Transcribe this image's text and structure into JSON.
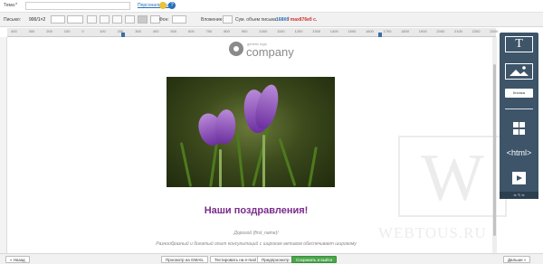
{
  "topbar": {
    "subject_label": "Тема:*",
    "subject_value": "",
    "personalize_link": "Персонализация"
  },
  "toolbar": {
    "letter_label": "Письмо:",
    "width_value": "900/1×2",
    "background_label": "Фон:",
    "attachment_label": "Вложение:",
    "total_size_label": "Сум. объем письма:",
    "total_size_value": "168Кб",
    "size_limit_value": "/ max876кб с."
  },
  "ruler": {
    "ticks": [
      "400",
      "300",
      "200",
      "100",
      "0",
      "100",
      "200",
      "300",
      "400",
      "500",
      "600",
      "700",
      "800",
      "900",
      "1000",
      "1100",
      "1200",
      "1300",
      "1400",
      "1500",
      "1600",
      "1700",
      "1800",
      "1900",
      "2000",
      "2100",
      "2200",
      "2300"
    ]
  },
  "email": {
    "logo_small": "generic logo",
    "logo_big": "company",
    "heading": "Наши поздравления!",
    "greeting": "Дорогой {first_name}!",
    "body_text": "Разнообразный и богатый опыт консультаций с широким активом обеспечивает широкому"
  },
  "panel": {
    "text_icon": "T",
    "image_icon": "image-icon",
    "button_label": "Кнопка",
    "social_icon": "social-icon",
    "html_label": "<html>",
    "video_icon": "video-icon",
    "drag_label": "⇆ ⇅ ⇆"
  },
  "watermark": {
    "letter": "W",
    "text": "WEBTOUS.RU"
  },
  "footer": {
    "back_button": "« Назад",
    "preview_button": "Просмотр на GMAIL",
    "test_button": "Тестировать на e-mail",
    "preview_site_button": "Предпросмотр",
    "save_button": "Сохранить и выйти",
    "next_button": "Дальше »"
  },
  "colors": {
    "accent": "#2a6fb8",
    "heading": "#7a2b8c",
    "panel": "#3d5469",
    "save": "#4aa64a",
    "limit": "#d0302a"
  }
}
